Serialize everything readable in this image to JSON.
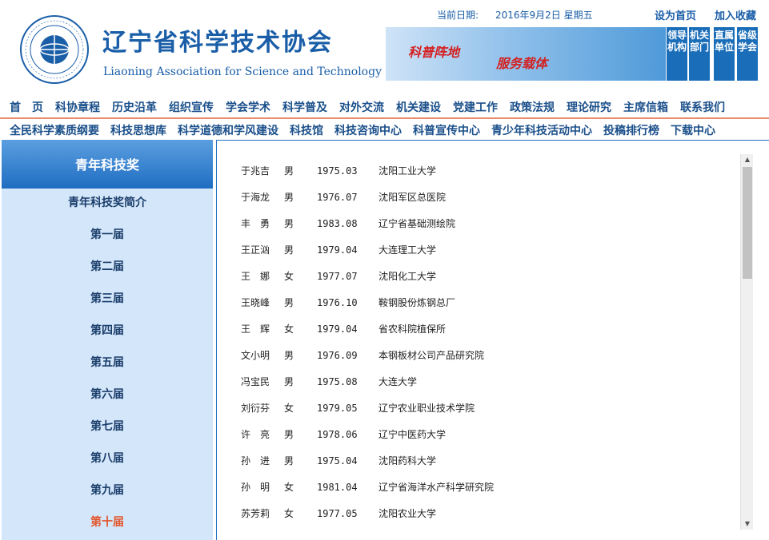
{
  "header": {
    "org_title": "辽宁省科学技术协会",
    "org_subtitle": "Liaoning Association for Science and Technology",
    "date_label": "当前日期:",
    "date_value": "2016年9月2日 星期五",
    "set_homepage": "设为首页",
    "add_favorite": "加入收藏",
    "banner_text1": "科普阵地",
    "banner_text2": "服务载体",
    "side_buttons": [
      "领导机构",
      "机关部门",
      "直属单位",
      "省级学会"
    ]
  },
  "nav_primary": [
    "首　页",
    "科协章程",
    "历史沿革",
    "组织宣传",
    "学会学术",
    "科学普及",
    "对外交流",
    "机关建设",
    "党建工作",
    "政策法规",
    "理论研究",
    "主席信箱",
    "联系我们"
  ],
  "nav_secondary": [
    "全民科学素质纲要",
    "科技思想库",
    "科学道德和学风建设",
    "科技馆",
    "科技咨询中心",
    "科普宣传中心",
    "青少年科技活动中心",
    "投稿排行榜",
    "下载中心"
  ],
  "sidebar": {
    "title": "青年科技奖",
    "items": [
      "青年科技奖简介",
      "第一届",
      "第二届",
      "第三届",
      "第四届",
      "第五届",
      "第六届",
      "第七届",
      "第八届",
      "第九届",
      "第十届"
    ],
    "active_index": 10
  },
  "awardees": [
    {
      "name": "于兆吉",
      "sex": "男",
      "year": "1975.03",
      "org": "沈阳工业大学"
    },
    {
      "name": "于海龙",
      "sex": "男",
      "year": "1976.07",
      "org": "沈阳军区总医院"
    },
    {
      "name": "丰　勇",
      "sex": "男",
      "year": "1983.08",
      "org": "辽宁省基础测绘院"
    },
    {
      "name": "王正汹",
      "sex": "男",
      "year": "1979.04",
      "org": "大连理工大学"
    },
    {
      "name": "王　娜",
      "sex": "女",
      "year": "1977.07",
      "org": "沈阳化工大学"
    },
    {
      "name": "王晓峰",
      "sex": "男",
      "year": "1976.10",
      "org": "鞍钢股份炼钢总厂"
    },
    {
      "name": "王　辉",
      "sex": "女",
      "year": "1979.04",
      "org": "省农科院植保所"
    },
    {
      "name": "文小明",
      "sex": "男",
      "year": "1976.09",
      "org": "本钢板材公司产品研究院"
    },
    {
      "name": "冯宝民",
      "sex": "男",
      "year": "1975.08",
      "org": "大连大学"
    },
    {
      "name": "刘衍芬",
      "sex": "女",
      "year": "1979.05",
      "org": "辽宁农业职业技术学院"
    },
    {
      "name": "许　亮",
      "sex": "男",
      "year": "1978.06",
      "org": "辽宁中医药大学"
    },
    {
      "name": "孙　进",
      "sex": "男",
      "year": "1975.04",
      "org": "沈阳药科大学"
    },
    {
      "name": "孙　明",
      "sex": "女",
      "year": "1981.04",
      "org": "辽宁省海洋水产科学研究院"
    },
    {
      "name": "苏芳莉",
      "sex": "女",
      "year": "1977.05",
      "org": "沈阳农业大学"
    }
  ],
  "colors": {
    "brand_blue": "#1a5ea8",
    "active": "#e2552b",
    "sidebar_bg": "#d4e7fa"
  }
}
